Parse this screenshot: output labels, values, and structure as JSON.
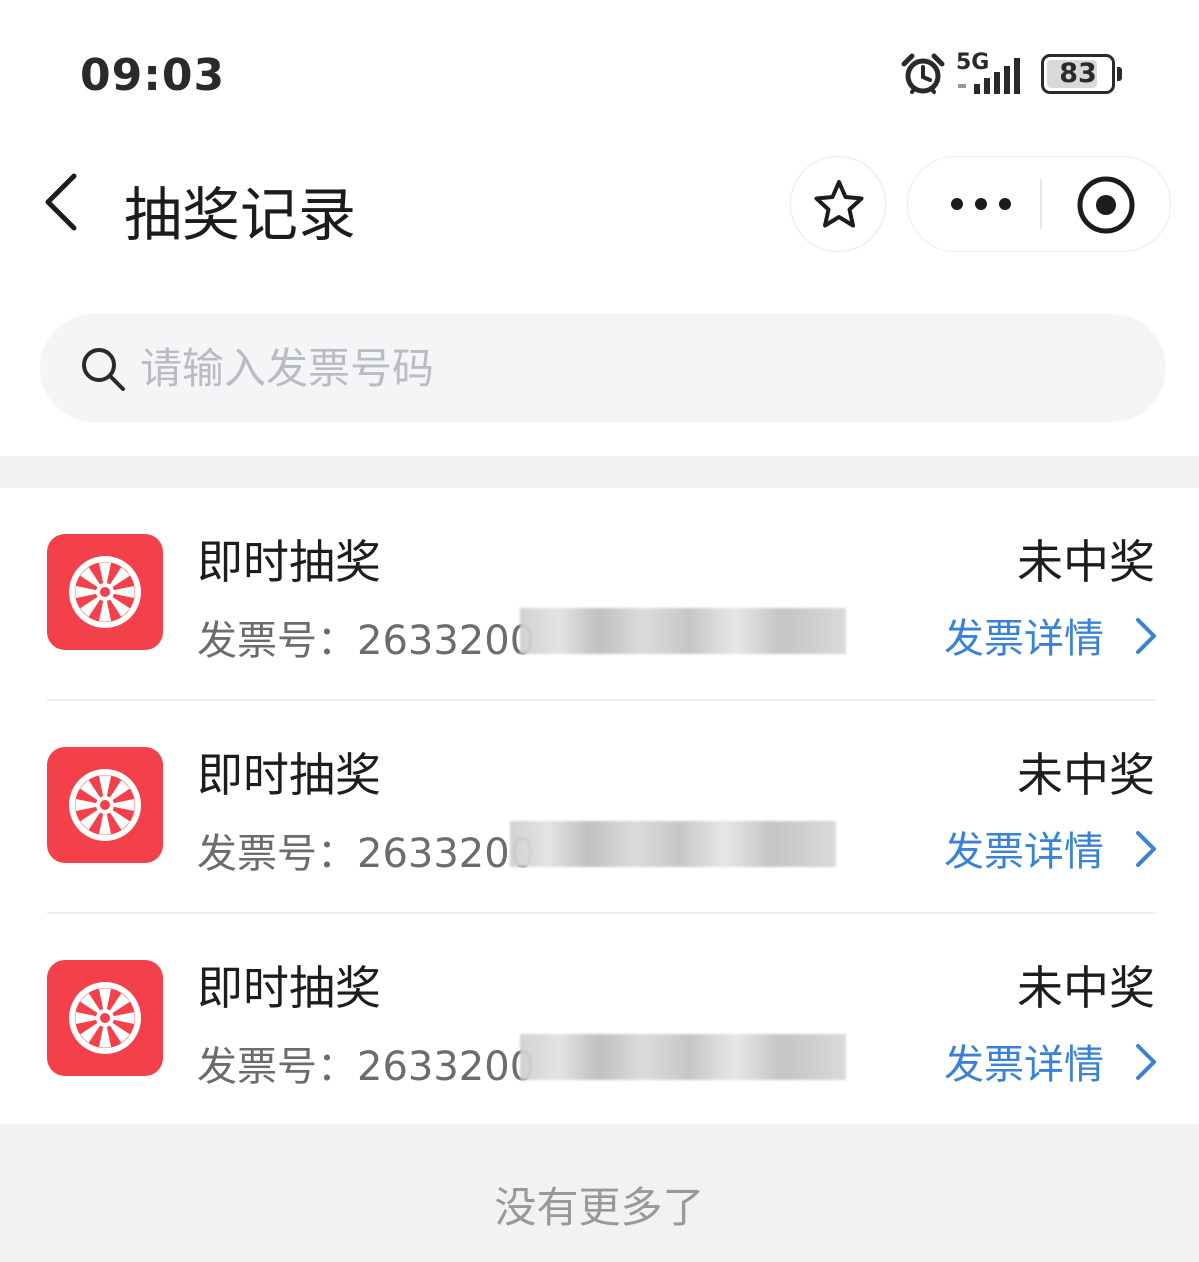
{
  "status_bar": {
    "time": "09:03",
    "network": "5G",
    "battery": "83",
    "battery_level": 0.83
  },
  "nav": {
    "title": "抽奖记录",
    "icons": [
      "back-icon",
      "star-icon",
      "more-icon",
      "close-miniprogram-icon"
    ]
  },
  "search": {
    "placeholder": "请输入发票号码",
    "value": ""
  },
  "records": [
    {
      "title": "即时抽奖",
      "status": "未中奖",
      "invoice_label": "发票号：",
      "invoice_number": "2633200",
      "detail_label": "发票详情"
    },
    {
      "title": "即时抽奖",
      "status": "未中奖",
      "invoice_label": "发票号：",
      "invoice_number": "2633200",
      "detail_label": "发票详情"
    },
    {
      "title": "即时抽奖",
      "status": "未中奖",
      "invoice_label": "发票号：",
      "invoice_number": "2633200",
      "detail_label": "发票详情"
    }
  ],
  "footer": {
    "text": "没有更多了"
  },
  "colors": {
    "accent": "#3a82d8",
    "icon_bg": "#f3404a",
    "footer_bg": "#f2f2f2",
    "search_bg": "#f4f5f7"
  }
}
